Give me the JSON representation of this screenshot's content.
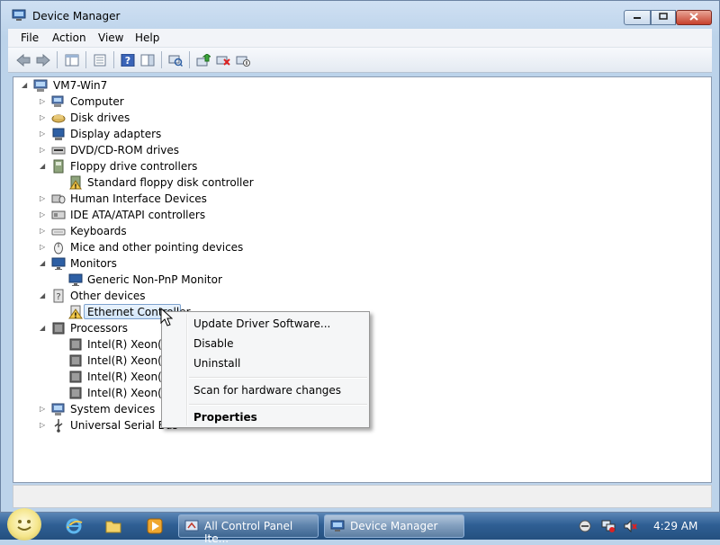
{
  "window": {
    "title": "Device Manager"
  },
  "menu": [
    "File",
    "Action",
    "View",
    "Help"
  ],
  "tree": {
    "root": "VM7-Win7",
    "items": [
      {
        "label": "Computer",
        "expanded": false
      },
      {
        "label": "Disk drives",
        "expanded": false
      },
      {
        "label": "Display adapters",
        "expanded": false
      },
      {
        "label": "DVD/CD-ROM drives",
        "expanded": false
      },
      {
        "label": "Floppy drive controllers",
        "expanded": true,
        "children": [
          "Standard floppy disk controller"
        ]
      },
      {
        "label": "Human Interface Devices",
        "expanded": false
      },
      {
        "label": "IDE ATA/ATAPI controllers",
        "expanded": false
      },
      {
        "label": "Keyboards",
        "expanded": false
      },
      {
        "label": "Mice and other pointing devices",
        "expanded": false
      },
      {
        "label": "Monitors",
        "expanded": true,
        "children": [
          "Generic Non-PnP Monitor"
        ]
      },
      {
        "label": "Other devices",
        "expanded": true,
        "children": [
          "Ethernet Controller"
        ]
      },
      {
        "label": "Processors",
        "expanded": true,
        "children": [
          "Intel(R) Xeon(R)",
          "Intel(R) Xeon(R)",
          "Intel(R) Xeon(R)",
          "Intel(R) Xeon(R)"
        ]
      },
      {
        "label": "System devices",
        "expanded": false
      },
      {
        "label": "Universal Serial Bus",
        "expanded": false
      }
    ]
  },
  "context_menu": {
    "update": "Update Driver Software...",
    "disable": "Disable",
    "uninstall": "Uninstall",
    "scan": "Scan for hardware changes",
    "properties": "Properties"
  },
  "taskbar": {
    "tasks": [
      "All Control Panel Ite...",
      "Device Manager"
    ],
    "clock": "4:29 AM"
  }
}
